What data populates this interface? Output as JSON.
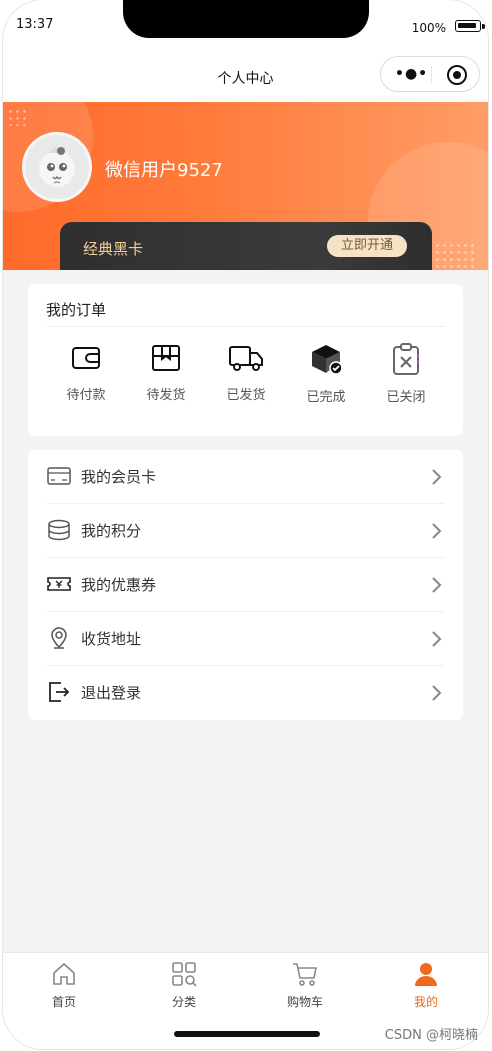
{
  "status_bar": {
    "time": "13:37",
    "battery": "100%"
  },
  "nav": {
    "title": "个人中心",
    "more_icon": "more-dots-icon",
    "close_icon": "target-icon"
  },
  "profile": {
    "username": "微信用户9527",
    "avatar_icon": "cartoon-avatar"
  },
  "vip": {
    "label": "经典黑卡",
    "button": "立即开通"
  },
  "orders": {
    "title": "我的订单",
    "items": [
      {
        "label": "待付款",
        "icon": "wallet-icon"
      },
      {
        "label": "待发货",
        "icon": "package-icon"
      },
      {
        "label": "已发货",
        "icon": "truck-icon"
      },
      {
        "label": "已完成",
        "icon": "box-check-icon"
      },
      {
        "label": "已关闭",
        "icon": "clipboard-x-icon"
      }
    ]
  },
  "menu": [
    {
      "label": "我的会员卡",
      "icon": "card-icon"
    },
    {
      "label": "我的积分",
      "icon": "coins-icon"
    },
    {
      "label": "我的优惠券",
      "icon": "coupon-icon"
    },
    {
      "label": "收货地址",
      "icon": "location-icon"
    },
    {
      "label": "退出登录",
      "icon": "logout-icon"
    }
  ],
  "tabs": [
    {
      "label": "首页",
      "icon": "home-icon"
    },
    {
      "label": "分类",
      "icon": "grid-icon"
    },
    {
      "label": "购物车",
      "icon": "cart-icon"
    },
    {
      "label": "我的",
      "icon": "user-icon",
      "active": true
    }
  ],
  "watermark": "CSDN @柯晓楠",
  "colors": {
    "accent": "#ff6a2b",
    "active_tab": "#f06a1d",
    "vip_gold": "#f1cf9c"
  }
}
